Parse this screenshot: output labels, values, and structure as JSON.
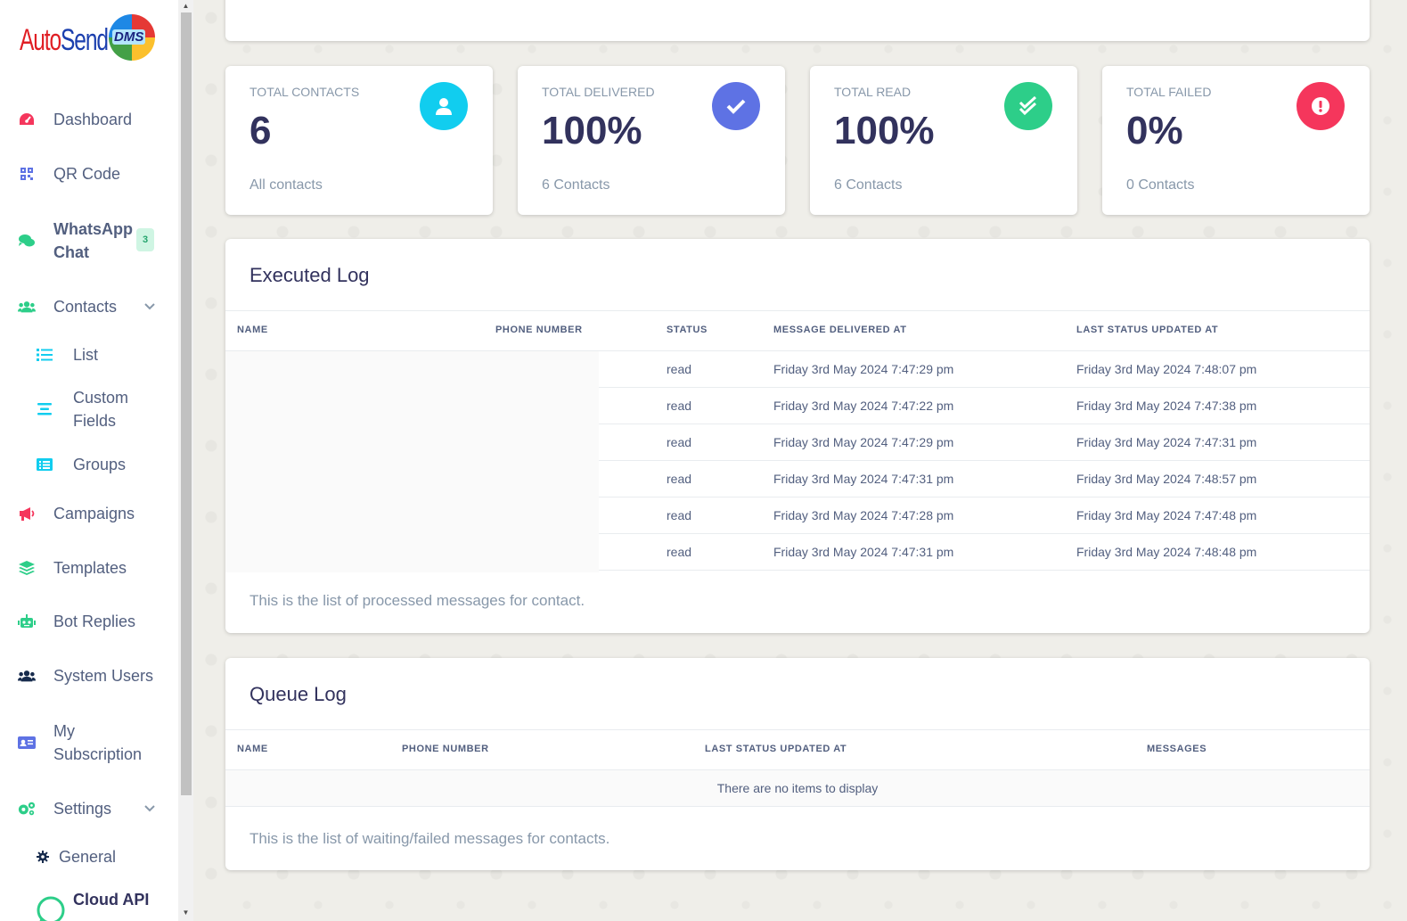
{
  "brand": {
    "name_part1": "Auto",
    "name_part2": "Send",
    "badge": "DMS"
  },
  "sidebar": {
    "items": [
      {
        "label": "Dashboard",
        "icon": "dashboard-icon",
        "color": "#f5365c"
      },
      {
        "label": "QR Code",
        "icon": "qr-code-icon",
        "color": "#5e72e4"
      },
      {
        "label": "WhatsApp Chat",
        "icon": "chat-icon",
        "color": "#2dce89",
        "badge": "3"
      },
      {
        "label": "Contacts",
        "icon": "users-icon",
        "color": "#2dce89"
      },
      {
        "label": "List",
        "icon": "list-icon",
        "color": "#11cdef"
      },
      {
        "label": "Custom Fields",
        "icon": "align-icon",
        "color": "#11cdef"
      },
      {
        "label": "Groups",
        "icon": "group-icon",
        "color": "#11cdef"
      },
      {
        "label": "Campaigns",
        "icon": "megaphone-icon",
        "color": "#f5365c"
      },
      {
        "label": "Templates",
        "icon": "layers-icon",
        "color": "#2dce89"
      },
      {
        "label": "Bot Replies",
        "icon": "robot-icon",
        "color": "#2dce89"
      },
      {
        "label": "System Users",
        "icon": "users-icon",
        "color": "#172b4d"
      },
      {
        "label": "My Subscription",
        "icon": "id-card-icon",
        "color": "#5e72e4"
      },
      {
        "label": "Settings",
        "icon": "cogs-icon",
        "color": "#2dce89"
      },
      {
        "label": "General",
        "icon": "gear-icon",
        "color": "#172b4d"
      },
      {
        "label": "Cloud API",
        "icon": "whatsapp-icon",
        "color": "#2dce89"
      }
    ]
  },
  "stats": [
    {
      "title": "TOTAL CONTACTS",
      "value": "6",
      "sub": "All contacts",
      "icon": "user-icon",
      "color": "#11cdef"
    },
    {
      "title": "TOTAL DELIVERED",
      "value": "100%",
      "sub": "6 Contacts",
      "icon": "check-icon",
      "color": "#5e72e4"
    },
    {
      "title": "TOTAL READ",
      "value": "100%",
      "sub": "6 Contacts",
      "icon": "double-check-icon",
      "color": "#2dce89"
    },
    {
      "title": "TOTAL FAILED",
      "value": "0%",
      "sub": "0 Contacts",
      "icon": "exclamation-icon",
      "color": "#f5365c"
    }
  ],
  "executed_log": {
    "title": "Executed Log",
    "columns": [
      "NAME",
      "PHONE NUMBER",
      "STATUS",
      "MESSAGE DELIVERED AT",
      "LAST STATUS UPDATED AT"
    ],
    "rows": [
      {
        "status": "read",
        "delivered": "Friday 3rd May 2024 7:47:29 pm",
        "updated": "Friday 3rd May 2024 7:48:07 pm"
      },
      {
        "status": "read",
        "delivered": "Friday 3rd May 2024 7:47:22 pm",
        "updated": "Friday 3rd May 2024 7:47:38 pm"
      },
      {
        "status": "read",
        "delivered": "Friday 3rd May 2024 7:47:29 pm",
        "updated": "Friday 3rd May 2024 7:47:31 pm"
      },
      {
        "status": "read",
        "delivered": "Friday 3rd May 2024 7:47:31 pm",
        "updated": "Friday 3rd May 2024 7:48:57 pm"
      },
      {
        "status": "read",
        "delivered": "Friday 3rd May 2024 7:47:28 pm",
        "updated": "Friday 3rd May 2024 7:47:48 pm"
      },
      {
        "status": "read",
        "delivered": "Friday 3rd May 2024 7:47:31 pm",
        "updated": "Friday 3rd May 2024 7:48:48 pm"
      }
    ],
    "footnote": "This is the list of processed messages for contact."
  },
  "queue_log": {
    "title": "Queue Log",
    "columns": [
      "NAME",
      "PHONE NUMBER",
      "LAST STATUS UPDATED AT",
      "MESSAGES"
    ],
    "empty": "There are no items to display",
    "footnote": "This is the list of waiting/failed messages for contacts."
  }
}
